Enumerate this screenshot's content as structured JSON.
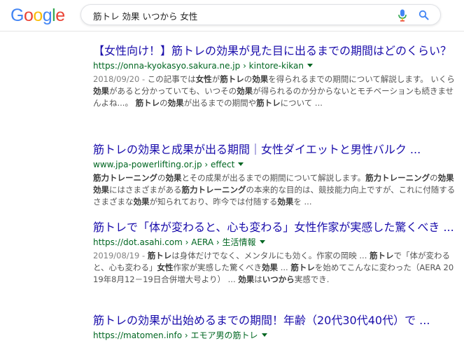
{
  "header": {
    "logo_letters": [
      {
        "ch": "G",
        "color": "#4285F4"
      },
      {
        "ch": "o",
        "color": "#EA4335"
      },
      {
        "ch": "o",
        "color": "#FBBC05"
      },
      {
        "ch": "g",
        "color": "#4285F4"
      },
      {
        "ch": "l",
        "color": "#34A853"
      },
      {
        "ch": "e",
        "color": "#EA4335"
      }
    ],
    "search_query": "筋トレ 効果 いつから 女性",
    "icons": {
      "mic": "microphone-icon",
      "search": "search-icon"
    },
    "accent_color": "#4285F4"
  },
  "results": [
    {
      "title": "【女性向け！】筋トレの効果が見た目に出るまでの期間はどのくらい？",
      "url": "https://onna-kyokasyo.sakura.ne.jp › kintore-kikan",
      "snippet_html": "<span class=\"date\">2018/09/20 - </span>この記事では<b>女性</b>が<b>筋トレ</b>の<b>効果</b>を得られるまでの期間について解説します。 いくら<b>効果</b>があると分かっていても、いつその<b>効果</b>が得られるのか分からないとモチベーションも続きませんよね...。 <b>筋トレ</b>の<b>効果</b>が出るまでの期間や<b>筋トレ</b>について ..."
    },
    {
      "title": "筋トレの効果と成果が出る期間｜女性ダイエットと男性バルク ...",
      "url": "www.jpa-powerlifting.or.jp › effect",
      "snippet_html": "<b>筋力トレーニング</b>の<b>効果</b>とその成果が出るまでの期間について解説します。<b>筋力トレーニング</b>の<b>効果効果</b>にはさまざまがある<b>筋力トレーニング</b>の本来的な目的は、競技能力向上ですが、これに付随するさまざまな<b>効果</b>が知られており、昨今では付随する<b>効果</b>を ..."
    },
    {
      "title": "筋トレで「体が変わると、心も変わる」女性作家が実感した驚くべき ...",
      "url": "https://dot.asahi.com › AERA › 生活情報",
      "snippet_html": "<span class=\"date\">2019/08/19 - </span><b>筋トレ</b>は身体だけでなく、メンタルにも効く。作家の岡映 ... <b>筋トレ</b>で「体が変わると、心も変わる」<b>女性</b>作家が実感した驚くべき<b>効果</b> ... <b>筋トレ</b>を始めてこんなに変わった（AERA 2019年8月12－19日合併増大号より） ... <b>効果</b>は<b>いつから</b>実感でき."
    },
    {
      "title": "筋トレの効果が出始めるまでの期間！年齢（20代30代40代）で ...",
      "url": "https://matomen.info › エモア男の筋トレ",
      "snippet_html": ""
    }
  ]
}
